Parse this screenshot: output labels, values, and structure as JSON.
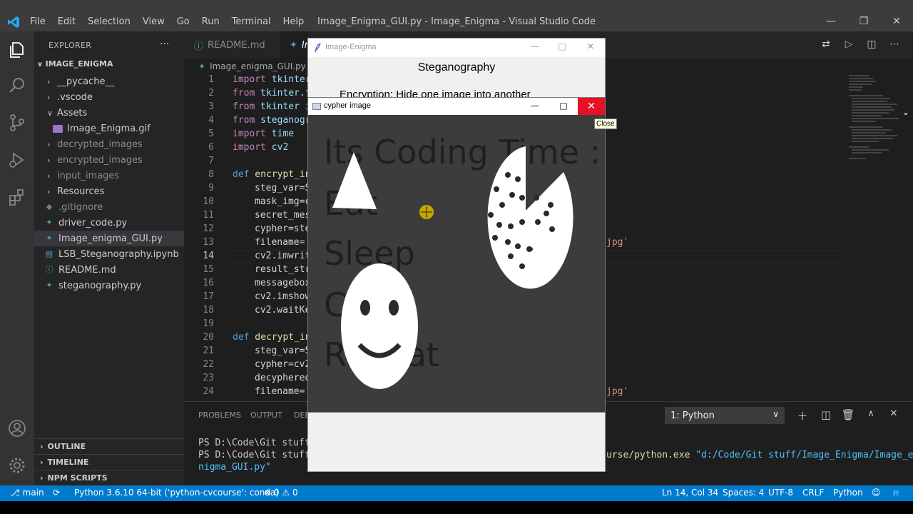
{
  "menu": [
    "File",
    "Edit",
    "Selection",
    "View",
    "Go",
    "Run",
    "Terminal",
    "Help"
  ],
  "window_title": "Image_Enigma_GUI.py - Image_Enigma - Visual Studio Code",
  "explorer": {
    "header": "EXPLORER",
    "more": "···",
    "root": "IMAGE_ENIGMA",
    "items": [
      {
        "label": "__pycache__",
        "kind": "folder"
      },
      {
        "label": ".vscode",
        "kind": "folder"
      },
      {
        "label": "Assets",
        "kind": "folder-open"
      },
      {
        "label": "Image_Enigma.gif",
        "kind": "image"
      },
      {
        "label": "decrypted_images",
        "kind": "folder"
      },
      {
        "label": "encrypted_images",
        "kind": "folder"
      },
      {
        "label": "input_images",
        "kind": "folder"
      },
      {
        "label": "Resources",
        "kind": "folder"
      },
      {
        "label": ".gitignore",
        "kind": "file"
      },
      {
        "label": "driver_code.py",
        "kind": "python"
      },
      {
        "label": "Image_enigma_GUI.py",
        "kind": "python"
      },
      {
        "label": "LSB_Steganography.ipynb",
        "kind": "notebook"
      },
      {
        "label": "README.md",
        "kind": "info"
      },
      {
        "label": "steganography.py",
        "kind": "python"
      }
    ],
    "sections": [
      "OUTLINE",
      "TIMELINE",
      "NPM SCRIPTS"
    ]
  },
  "tabs": [
    {
      "label": "README.md",
      "active": false
    },
    {
      "label": "Im",
      "active": true
    }
  ],
  "breadcrumb": "Image_enigma_GUI.py",
  "code": {
    "lines": [
      "1",
      "2",
      "3",
      "4",
      "5",
      "6",
      "7",
      "8",
      "9",
      "10",
      "11",
      "12",
      "13",
      "14",
      "15",
      "16",
      "17",
      "18",
      "19",
      "20",
      "21",
      "22",
      "23",
      "24"
    ],
    "current_line": "14",
    "l1": [
      "import",
      " tkinter"
    ],
    "l2": [
      "from",
      " tkinter.f"
    ],
    "l3": [
      "from",
      " tkinter i"
    ],
    "l4": [
      "from",
      " steganogr"
    ],
    "l5": [
      "import",
      " time"
    ],
    "l6": [
      "import",
      " cv2"
    ],
    "l8": [
      "def",
      " encrypt_in"
    ],
    "l9": "steg_var=S",
    "l10": "mask_img=c",
    "l11": "secret_mes",
    "l12": "cypher=ste",
    "l13": "filename='",
    "l14": "cv2.imwrit",
    "l15": "result_str",
    "l16": "messagebox",
    "l17": "cv2.imshow",
    "l18": "cv2.waitKe",
    "l20": [
      "def",
      " decrypt_in"
    ],
    "l21": "steg_var=S",
    "l22": "cypher=cv2",
    "l23": "decyphered",
    "l24": "filename='",
    "tail13": "jpg'",
    "tail24": "jpg'"
  },
  "panel": {
    "tabs": [
      "PROBLEMS",
      "OUTPUT",
      "DEB"
    ],
    "terminal_select": "1: Python",
    "lines": [
      "PS D:\\Code\\Git stuff\\",
      "PS D:\\Code\\Git stuff\\"
    ],
    "line2_tail_a": "urse/python.exe",
    "line2_tail_b": " \"d:/Code/Git stuff/Image_Enigma/Image_e",
    "line3": "nigma_GUI.py\""
  },
  "status": {
    "branch": "main",
    "python": "Python 3.6.10 64-bit ('python-cvcourse': conda)",
    "errors": "0",
    "warnings": "0",
    "position": "Ln 14, Col 34",
    "spaces": "Spaces: 4",
    "encoding": "UTF-8",
    "eol": "CRLF",
    "language": "Python"
  },
  "tk_window": {
    "title": "Image-Enigma",
    "heading": "Steganography",
    "subheading": "Encryption: Hide one image into another"
  },
  "cv_window": {
    "title": "cypher image",
    "tooltip": "Close",
    "image_text": [
      "Its Coding Time :",
      "Eat",
      "Sleep",
      "Code",
      "Repeat"
    ]
  },
  "colors": {
    "accent": "#007acc",
    "close_red": "#e81123",
    "cursor_yellow": "#c8a600"
  }
}
